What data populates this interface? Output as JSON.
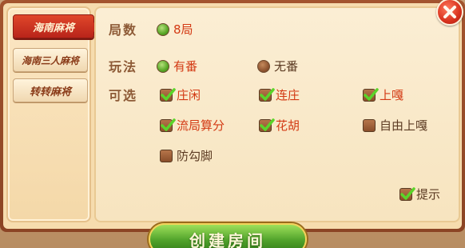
{
  "sidebar": {
    "tabs": [
      {
        "label": "海南麻将",
        "active": true
      },
      {
        "label": "海南三人麻将",
        "active": false
      },
      {
        "label": "转转麻将",
        "active": false
      }
    ]
  },
  "panel": {
    "rounds": {
      "label": "局数",
      "options": [
        {
          "label": "8局",
          "selected": true
        }
      ]
    },
    "mode": {
      "label": "玩法",
      "options": [
        {
          "label": "有番",
          "selected": true
        },
        {
          "label": "无番",
          "selected": false
        }
      ]
    },
    "extras": {
      "label": "可选",
      "options": [
        {
          "label": "庄闲",
          "checked": true
        },
        {
          "label": "连庄",
          "checked": true
        },
        {
          "label": "上嘎",
          "checked": true
        },
        {
          "label": "流局算分",
          "checked": true
        },
        {
          "label": "花胡",
          "checked": true
        },
        {
          "label": "自由上嘎",
          "checked": false
        },
        {
          "label": "防勾脚",
          "checked": false
        }
      ]
    },
    "hint": {
      "label": "提示",
      "checked": true
    }
  },
  "create_button": {
    "label": "创建房间"
  },
  "colors": {
    "accent_red": "#d33a14",
    "tab_active": "#c42d1d",
    "button_green": "#4fa12a",
    "label_brown": "#8d5a36"
  }
}
